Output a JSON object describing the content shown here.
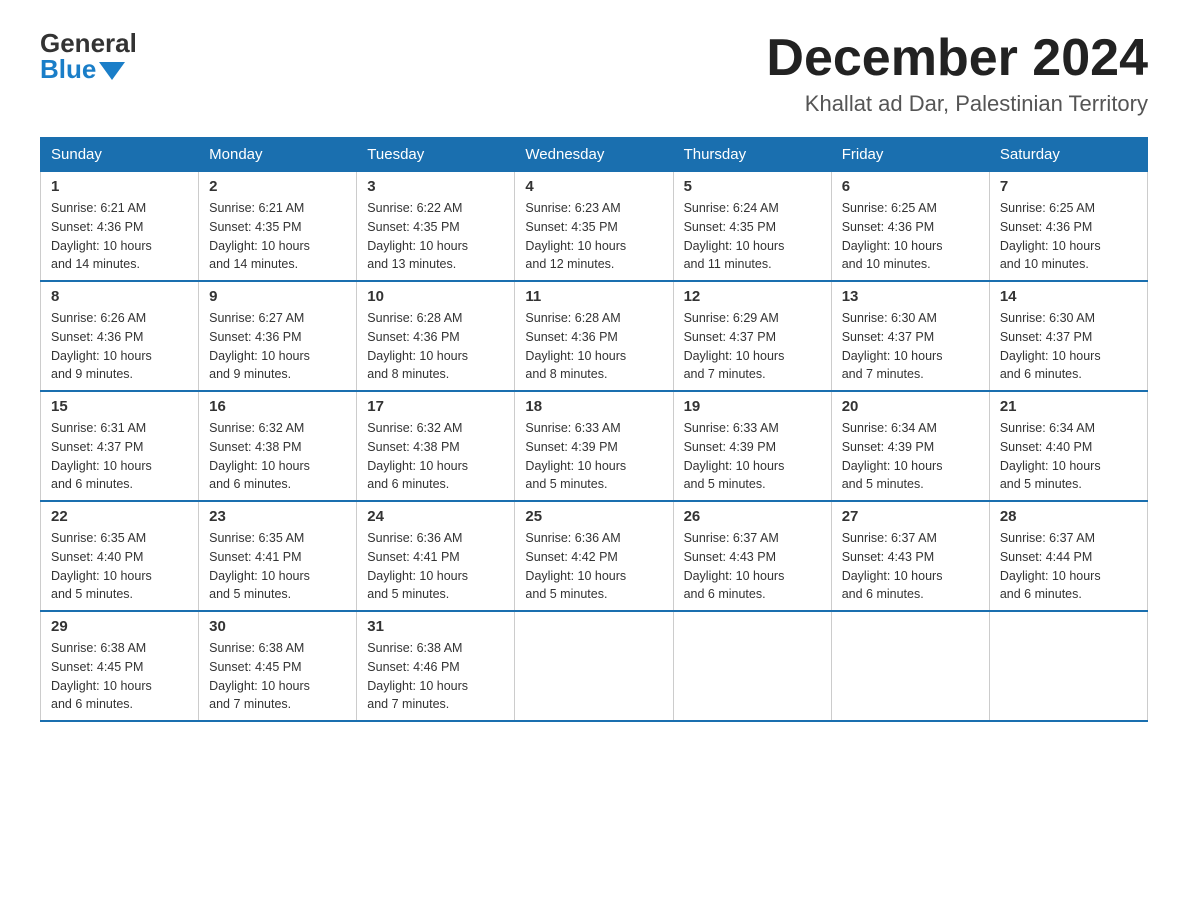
{
  "header": {
    "logo_general": "General",
    "logo_blue": "Blue",
    "month_title": "December 2024",
    "location": "Khallat ad Dar, Palestinian Territory"
  },
  "days_of_week": [
    "Sunday",
    "Monday",
    "Tuesday",
    "Wednesday",
    "Thursday",
    "Friday",
    "Saturday"
  ],
  "weeks": [
    [
      {
        "day": "1",
        "sunrise": "6:21 AM",
        "sunset": "4:36 PM",
        "daylight": "10 hours and 14 minutes."
      },
      {
        "day": "2",
        "sunrise": "6:21 AM",
        "sunset": "4:35 PM",
        "daylight": "10 hours and 14 minutes."
      },
      {
        "day": "3",
        "sunrise": "6:22 AM",
        "sunset": "4:35 PM",
        "daylight": "10 hours and 13 minutes."
      },
      {
        "day": "4",
        "sunrise": "6:23 AM",
        "sunset": "4:35 PM",
        "daylight": "10 hours and 12 minutes."
      },
      {
        "day": "5",
        "sunrise": "6:24 AM",
        "sunset": "4:35 PM",
        "daylight": "10 hours and 11 minutes."
      },
      {
        "day": "6",
        "sunrise": "6:25 AM",
        "sunset": "4:36 PM",
        "daylight": "10 hours and 10 minutes."
      },
      {
        "day": "7",
        "sunrise": "6:25 AM",
        "sunset": "4:36 PM",
        "daylight": "10 hours and 10 minutes."
      }
    ],
    [
      {
        "day": "8",
        "sunrise": "6:26 AM",
        "sunset": "4:36 PM",
        "daylight": "10 hours and 9 minutes."
      },
      {
        "day": "9",
        "sunrise": "6:27 AM",
        "sunset": "4:36 PM",
        "daylight": "10 hours and 9 minutes."
      },
      {
        "day": "10",
        "sunrise": "6:28 AM",
        "sunset": "4:36 PM",
        "daylight": "10 hours and 8 minutes."
      },
      {
        "day": "11",
        "sunrise": "6:28 AM",
        "sunset": "4:36 PM",
        "daylight": "10 hours and 8 minutes."
      },
      {
        "day": "12",
        "sunrise": "6:29 AM",
        "sunset": "4:37 PM",
        "daylight": "10 hours and 7 minutes."
      },
      {
        "day": "13",
        "sunrise": "6:30 AM",
        "sunset": "4:37 PM",
        "daylight": "10 hours and 7 minutes."
      },
      {
        "day": "14",
        "sunrise": "6:30 AM",
        "sunset": "4:37 PM",
        "daylight": "10 hours and 6 minutes."
      }
    ],
    [
      {
        "day": "15",
        "sunrise": "6:31 AM",
        "sunset": "4:37 PM",
        "daylight": "10 hours and 6 minutes."
      },
      {
        "day": "16",
        "sunrise": "6:32 AM",
        "sunset": "4:38 PM",
        "daylight": "10 hours and 6 minutes."
      },
      {
        "day": "17",
        "sunrise": "6:32 AM",
        "sunset": "4:38 PM",
        "daylight": "10 hours and 6 minutes."
      },
      {
        "day": "18",
        "sunrise": "6:33 AM",
        "sunset": "4:39 PM",
        "daylight": "10 hours and 5 minutes."
      },
      {
        "day": "19",
        "sunrise": "6:33 AM",
        "sunset": "4:39 PM",
        "daylight": "10 hours and 5 minutes."
      },
      {
        "day": "20",
        "sunrise": "6:34 AM",
        "sunset": "4:39 PM",
        "daylight": "10 hours and 5 minutes."
      },
      {
        "day": "21",
        "sunrise": "6:34 AM",
        "sunset": "4:40 PM",
        "daylight": "10 hours and 5 minutes."
      }
    ],
    [
      {
        "day": "22",
        "sunrise": "6:35 AM",
        "sunset": "4:40 PM",
        "daylight": "10 hours and 5 minutes."
      },
      {
        "day": "23",
        "sunrise": "6:35 AM",
        "sunset": "4:41 PM",
        "daylight": "10 hours and 5 minutes."
      },
      {
        "day": "24",
        "sunrise": "6:36 AM",
        "sunset": "4:41 PM",
        "daylight": "10 hours and 5 minutes."
      },
      {
        "day": "25",
        "sunrise": "6:36 AM",
        "sunset": "4:42 PM",
        "daylight": "10 hours and 5 minutes."
      },
      {
        "day": "26",
        "sunrise": "6:37 AM",
        "sunset": "4:43 PM",
        "daylight": "10 hours and 6 minutes."
      },
      {
        "day": "27",
        "sunrise": "6:37 AM",
        "sunset": "4:43 PM",
        "daylight": "10 hours and 6 minutes."
      },
      {
        "day": "28",
        "sunrise": "6:37 AM",
        "sunset": "4:44 PM",
        "daylight": "10 hours and 6 minutes."
      }
    ],
    [
      {
        "day": "29",
        "sunrise": "6:38 AM",
        "sunset": "4:45 PM",
        "daylight": "10 hours and 6 minutes."
      },
      {
        "day": "30",
        "sunrise": "6:38 AM",
        "sunset": "4:45 PM",
        "daylight": "10 hours and 7 minutes."
      },
      {
        "day": "31",
        "sunrise": "6:38 AM",
        "sunset": "4:46 PM",
        "daylight": "10 hours and 7 minutes."
      },
      null,
      null,
      null,
      null
    ]
  ],
  "labels": {
    "sunrise": "Sunrise:",
    "sunset": "Sunset:",
    "daylight": "Daylight:"
  }
}
